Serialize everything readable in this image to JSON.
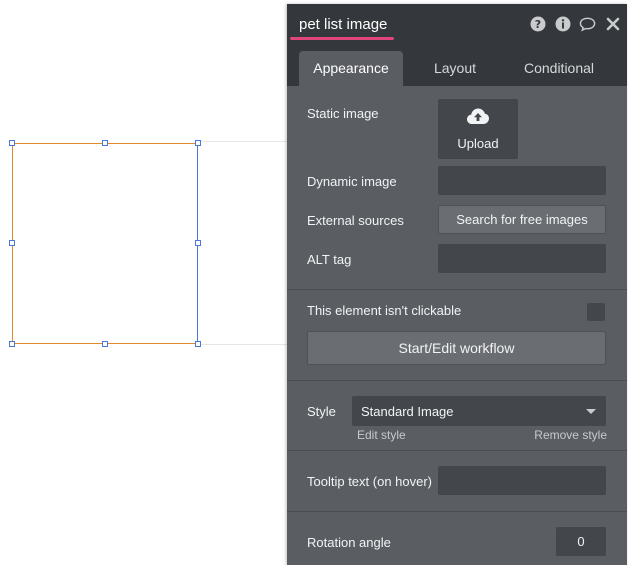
{
  "panel": {
    "title": "pet list image",
    "header_icons": [
      "help-icon",
      "info-icon",
      "comment-icon",
      "close-icon"
    ],
    "accent_color": "#e0457b"
  },
  "tabs": [
    {
      "label": "Appearance",
      "active": true
    },
    {
      "label": "Layout",
      "active": false
    },
    {
      "label": "Conditional",
      "active": false
    }
  ],
  "appearance": {
    "static_image_label": "Static image",
    "upload_label": "Upload",
    "upload_icon": "cloud-upload-icon",
    "dynamic_image_label": "Dynamic image",
    "dynamic_image_value": "",
    "external_sources_label": "External sources",
    "search_free_images_label": "Search for free images",
    "alt_tag_label": "ALT tag",
    "alt_tag_value": "",
    "not_clickable_label": "This element isn't clickable",
    "not_clickable_checked": false,
    "workflow_button_label": "Start/Edit workflow",
    "style_label": "Style",
    "style_value": "Standard Image",
    "edit_style_label": "Edit style",
    "remove_style_label": "Remove style",
    "tooltip_label": "Tooltip text (on hover)",
    "tooltip_value": "",
    "rotation_label": "Rotation angle",
    "rotation_value": "0"
  }
}
